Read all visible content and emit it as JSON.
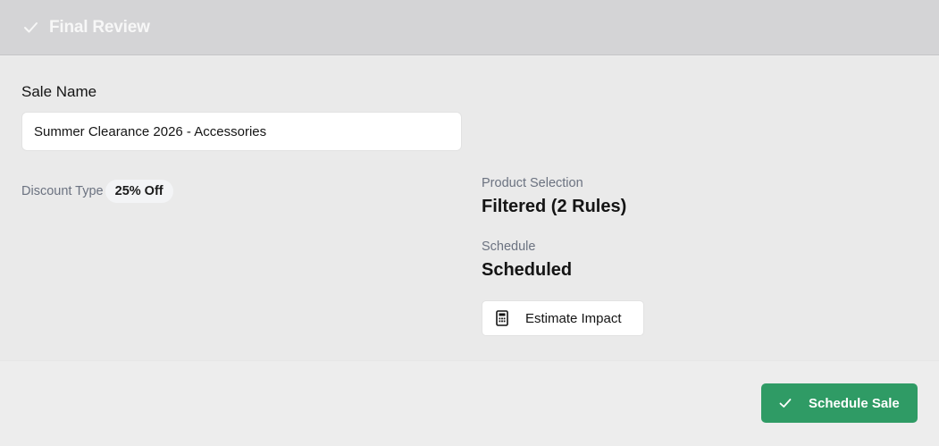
{
  "header": {
    "title": "Final Review",
    "icon": "check-icon"
  },
  "sale_name": {
    "label": "Sale Name",
    "value": "Summer Clearance 2026 - Accessories"
  },
  "discount": {
    "label": "Discount Type",
    "value": "25% Off"
  },
  "product_selection": {
    "label": "Product Selection",
    "value": "Filtered (2 Rules)"
  },
  "schedule": {
    "label": "Schedule",
    "value": "Scheduled"
  },
  "actions": {
    "estimate_label": "Estimate Impact",
    "estimate_icon": "calculator-icon",
    "schedule_label": "Schedule Sale",
    "schedule_icon": "check-icon"
  },
  "colors": {
    "primary": "#2f9b65",
    "header_bg": "#d4d4d6",
    "muted_text": "#6b7280"
  }
}
